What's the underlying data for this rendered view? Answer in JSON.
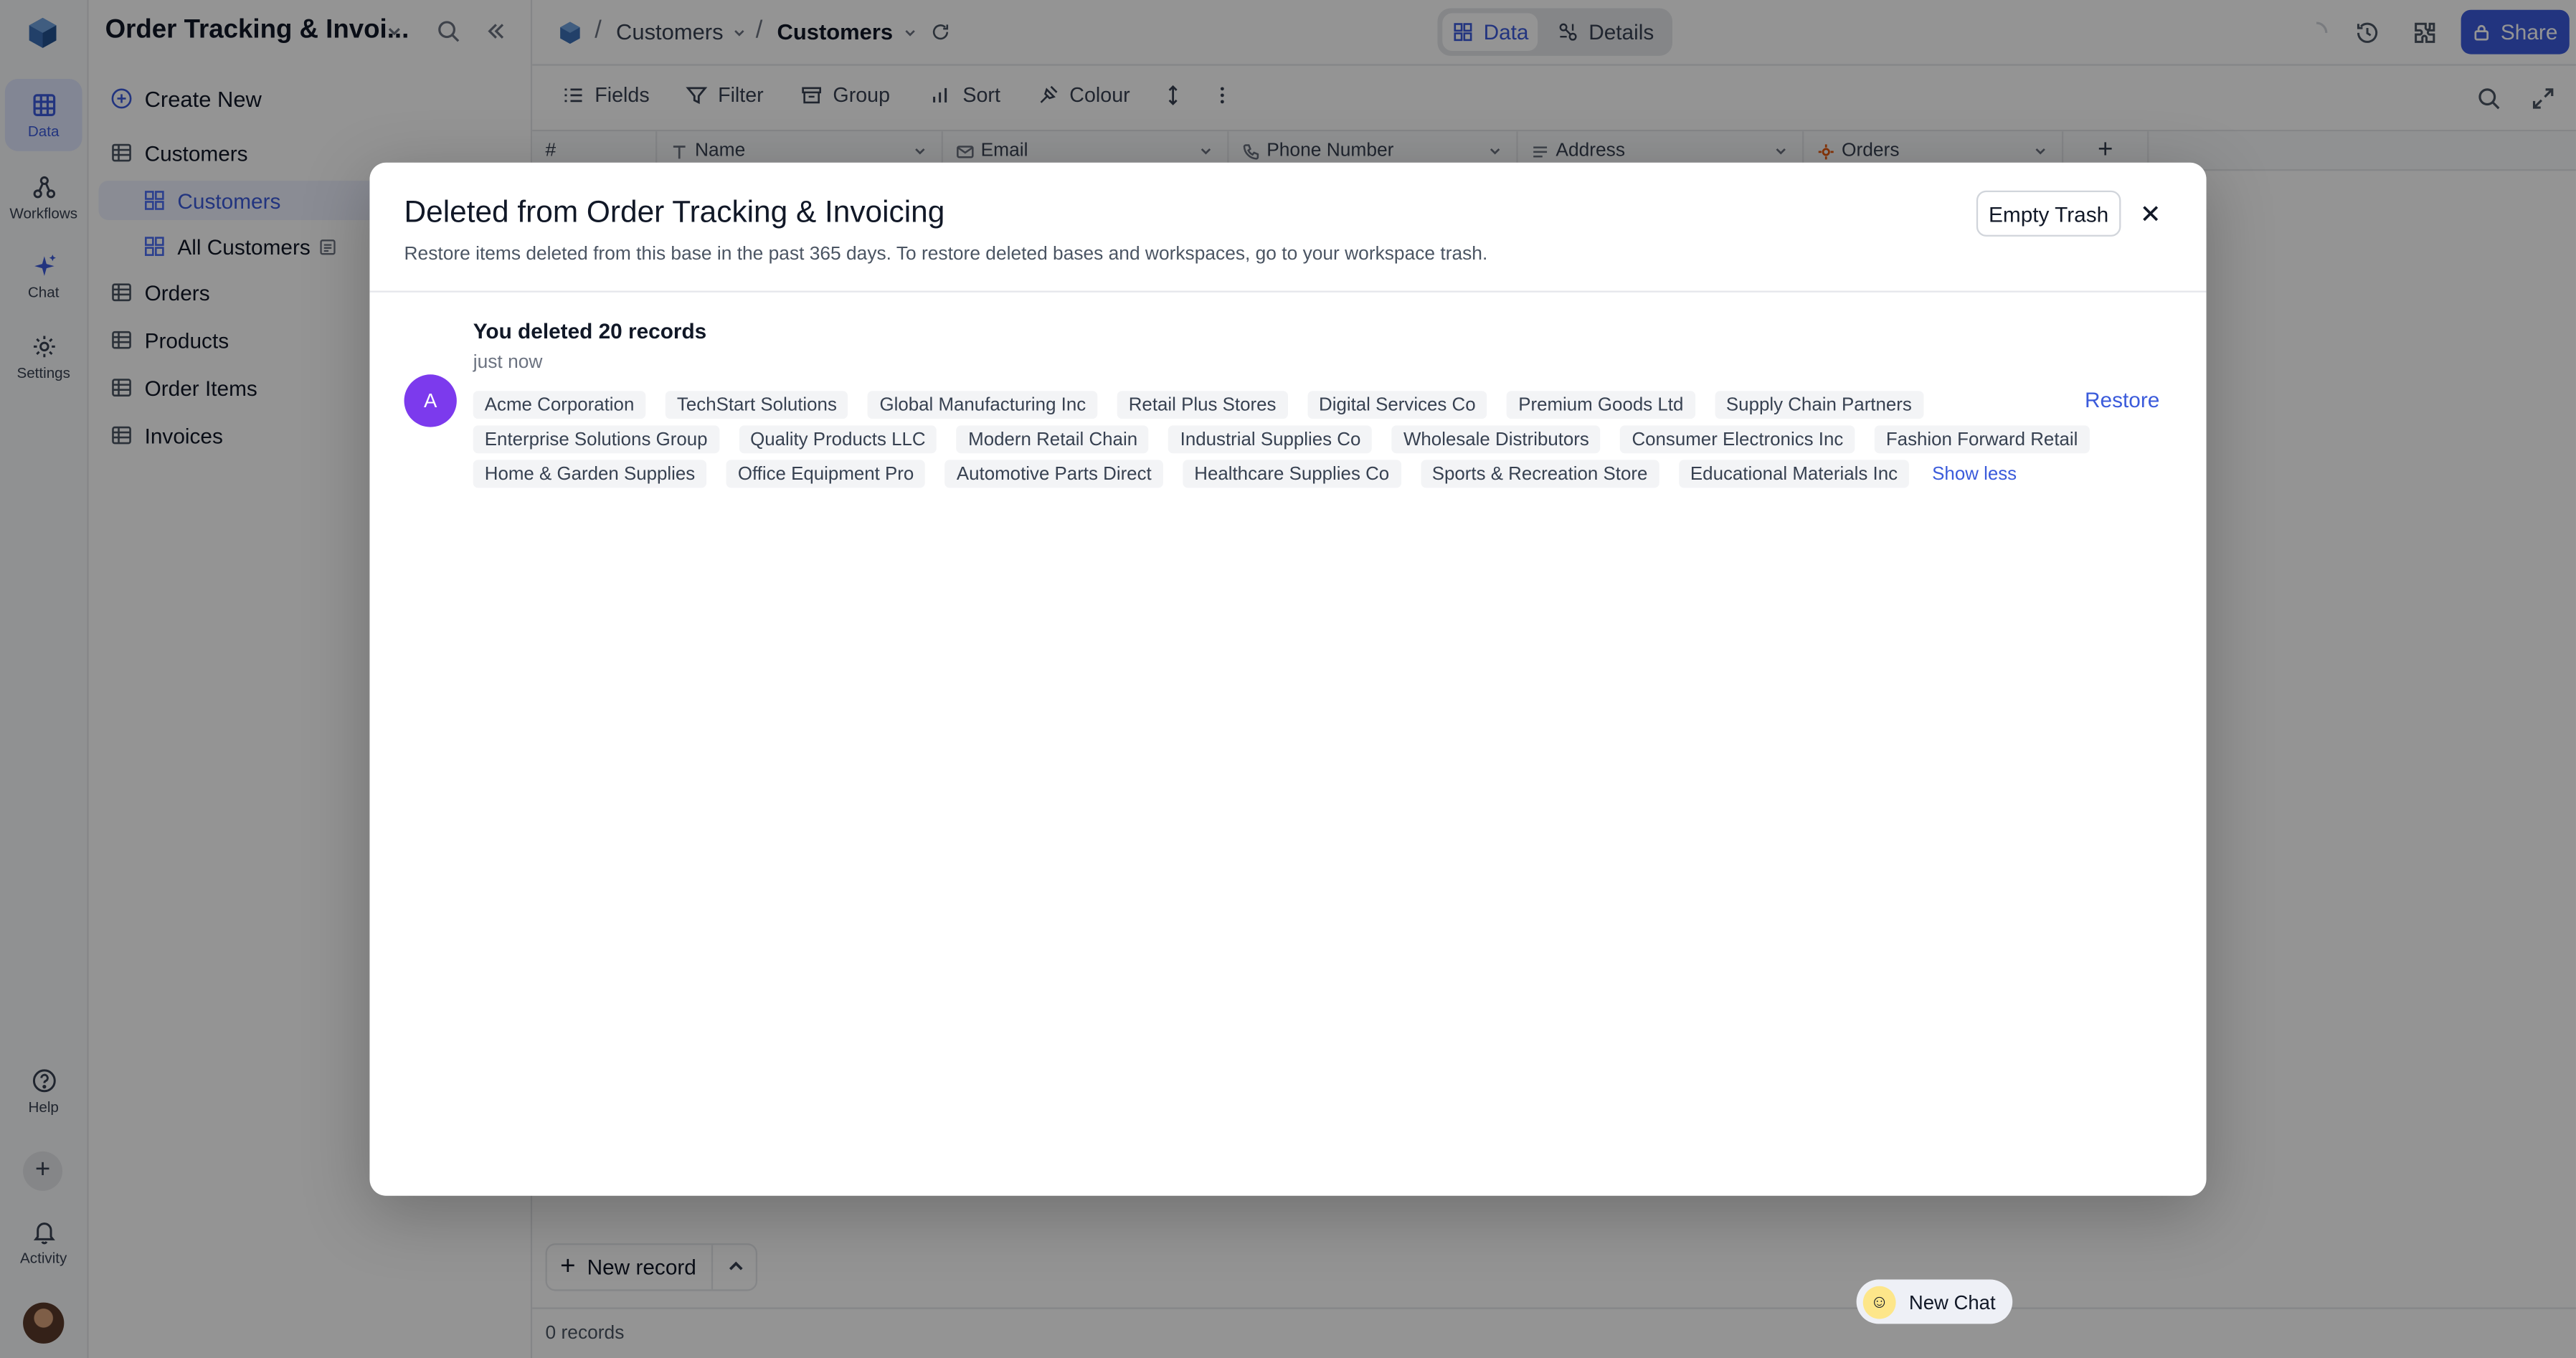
{
  "rail": {
    "items": [
      {
        "label": "Data",
        "icon": "grid-icon"
      },
      {
        "label": "Workflows",
        "icon": "workflow-icon"
      },
      {
        "label": "Chat",
        "icon": "sparkle-icon"
      },
      {
        "label": "Settings",
        "icon": "gear-icon"
      }
    ],
    "help": "Help",
    "activity": "Activity"
  },
  "side": {
    "title": "Order Tracking & Invoi...",
    "create_new": "Create New",
    "items": [
      {
        "label": "Customers"
      },
      {
        "label": "Customers"
      },
      {
        "label": "All Customers"
      },
      {
        "label": "Orders"
      },
      {
        "label": "Products"
      },
      {
        "label": "Order Items"
      },
      {
        "label": "Invoices"
      }
    ]
  },
  "topbar": {
    "crumb1": "Customers",
    "crumb2": "Customers",
    "tab_data": "Data",
    "tab_details": "Details",
    "share": "Share"
  },
  "toolbar": {
    "fields": "Fields",
    "filter": "Filter",
    "group": "Group",
    "sort": "Sort",
    "colour": "Colour"
  },
  "grid": {
    "columns": [
      "#",
      "Name",
      "Email",
      "Phone Number",
      "Address",
      "Orders"
    ],
    "new_record": "New record",
    "record_count": "0 records"
  },
  "new_chat": "New Chat",
  "modal": {
    "title": "Deleted from Order Tracking & Invoicing",
    "subtitle": "Restore items deleted from this base in the past 365 days. To restore deleted bases and workspaces, go to your workspace trash.",
    "empty_trash": "Empty Trash",
    "avatar_initial": "A",
    "heading": "You deleted 20 records",
    "time": "just now",
    "restore": "Restore",
    "show_less": "Show less",
    "tags": [
      [
        "Acme Corporation",
        "TechStart Solutions",
        "Global Manufacturing Inc",
        "Retail Plus Stores",
        "Digital Services Co",
        "Premium Goods Ltd",
        "Supply Chain Partners"
      ],
      [
        "Enterprise Solutions Group",
        "Quality Products LLC",
        "Modern Retail Chain",
        "Industrial Supplies Co",
        "Wholesale Distributors",
        "Consumer Electronics Inc",
        "Fashion Forward Retail"
      ],
      [
        "Home & Garden Supplies",
        "Office Equipment Pro",
        "Automotive Parts Direct",
        "Healthcare Supplies Co",
        "Sports & Recreation Store",
        "Educational Materials Inc"
      ]
    ]
  },
  "colors": {
    "accent": "#3b5bdb",
    "avatar": "#7c3aed"
  }
}
